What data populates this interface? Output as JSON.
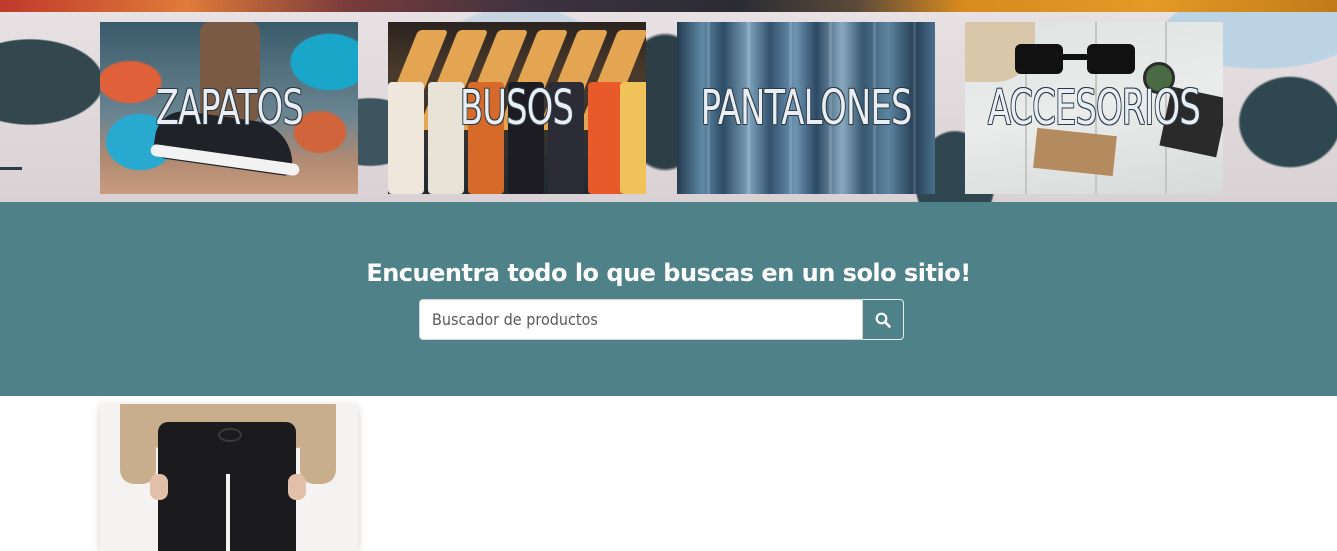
{
  "categories": [
    {
      "label": "ZAPATOS"
    },
    {
      "label": "BUSOS"
    },
    {
      "label": "PANTALONES"
    },
    {
      "label": "ACCESORIOS"
    }
  ],
  "search": {
    "tagline": "Encuentra todo lo que buscas en un solo sitio!",
    "placeholder": "Buscador de productos",
    "button_icon": "search-icon"
  },
  "colors": {
    "band": "#4f8189",
    "text_light": "#ffffff"
  },
  "products": [
    {
      "image": "black-jogger-pants"
    }
  ]
}
